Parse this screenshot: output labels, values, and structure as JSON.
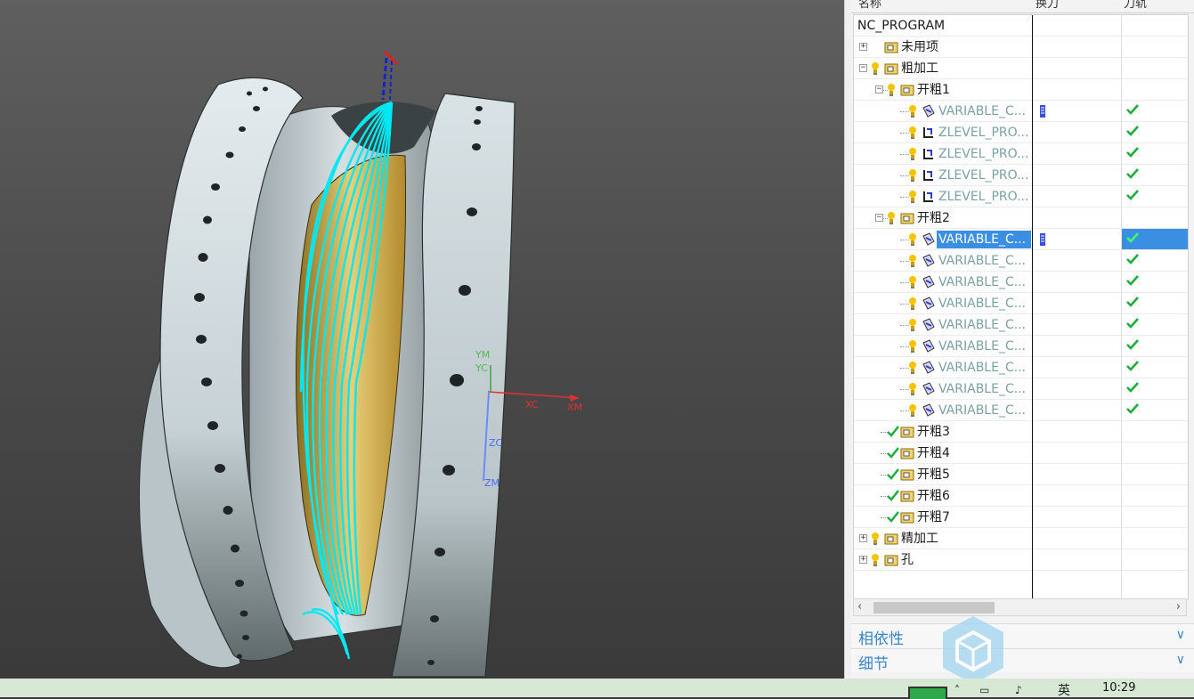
{
  "navigator": {
    "columns": {
      "name": "名称",
      "tool_change": "换刀",
      "toolpath": "刀轨"
    },
    "root": "NC_PROGRAM",
    "rows": [
      {
        "label": "未用项",
        "kind": "group",
        "level": 1,
        "expander": "+",
        "status": "none",
        "check": false
      },
      {
        "label": "粗加工",
        "kind": "group",
        "level": 1,
        "expander": "−",
        "status": "bulb",
        "check": false
      },
      {
        "label": "开粗1",
        "kind": "group",
        "level": 2,
        "expander": "−",
        "status": "bulb",
        "check": false
      },
      {
        "label": "VARIABLE_C...",
        "kind": "op-variable",
        "level": 3,
        "status": "bulb",
        "tool_change": true,
        "check": true
      },
      {
        "label": "ZLEVEL_PRO...",
        "kind": "op-zlevel",
        "level": 3,
        "status": "bulb",
        "tool_change": false,
        "check": true
      },
      {
        "label": "ZLEVEL_PRO...",
        "kind": "op-zlevel",
        "level": 3,
        "status": "bulb",
        "tool_change": false,
        "check": true
      },
      {
        "label": "ZLEVEL_PRO...",
        "kind": "op-zlevel",
        "level": 3,
        "status": "bulb",
        "tool_change": false,
        "check": true
      },
      {
        "label": "ZLEVEL_PRO...",
        "kind": "op-zlevel",
        "level": 3,
        "status": "bulb",
        "tool_change": false,
        "check": true
      },
      {
        "label": "开粗2",
        "kind": "group",
        "level": 2,
        "expander": "−",
        "status": "bulb",
        "check": false
      },
      {
        "label": "VARIABLE_C...",
        "kind": "op-variable",
        "level": 3,
        "status": "bulb",
        "tool_change": true,
        "check": true,
        "selected": true
      },
      {
        "label": "VARIABLE_C...",
        "kind": "op-variable",
        "level": 3,
        "status": "bulb",
        "tool_change": false,
        "check": true
      },
      {
        "label": "VARIABLE_C...",
        "kind": "op-variable",
        "level": 3,
        "status": "bulb",
        "tool_change": false,
        "check": true
      },
      {
        "label": "VARIABLE_C...",
        "kind": "op-variable",
        "level": 3,
        "status": "bulb",
        "tool_change": false,
        "check": true
      },
      {
        "label": "VARIABLE_C...",
        "kind": "op-variable",
        "level": 3,
        "status": "bulb",
        "tool_change": false,
        "check": true
      },
      {
        "label": "VARIABLE_C...",
        "kind": "op-variable",
        "level": 3,
        "status": "bulb",
        "tool_change": false,
        "check": true
      },
      {
        "label": "VARIABLE_C...",
        "kind": "op-variable",
        "level": 3,
        "status": "bulb",
        "tool_change": false,
        "check": true
      },
      {
        "label": "VARIABLE_C...",
        "kind": "op-variable",
        "level": 3,
        "status": "bulb",
        "tool_change": false,
        "check": true
      },
      {
        "label": "VARIABLE_C...",
        "kind": "op-variable",
        "level": 3,
        "status": "bulb",
        "tool_change": false,
        "check": true
      },
      {
        "label": "开粗3",
        "kind": "group",
        "level": 2,
        "status": "check",
        "check": false
      },
      {
        "label": "开粗4",
        "kind": "group",
        "level": 2,
        "status": "check",
        "check": false
      },
      {
        "label": "开粗5",
        "kind": "group",
        "level": 2,
        "status": "check",
        "check": false
      },
      {
        "label": "开粗6",
        "kind": "group",
        "level": 2,
        "status": "check",
        "check": false
      },
      {
        "label": "开粗7",
        "kind": "group",
        "level": 2,
        "status": "check",
        "check": false
      },
      {
        "label": "精加工",
        "kind": "group",
        "level": 1,
        "expander": "+",
        "status": "bulb",
        "check": false
      },
      {
        "label": "孔",
        "kind": "group",
        "level": 1,
        "expander": "+",
        "status": "bulb",
        "check": false
      }
    ]
  },
  "panels": {
    "dependencies": "相依性",
    "details": "细节"
  },
  "viewport": {
    "axis_labels": {
      "ym": "YM",
      "yc": "YC",
      "xc": "XC",
      "xm": "XM",
      "zc": "ZC",
      "zm": "ZM"
    }
  },
  "taskbar": {
    "time": "10:29",
    "ime": "英"
  },
  "colors": {
    "toolpath": "#00e5f0",
    "selection": "#3a8fe2",
    "check": "#1fae3c",
    "op_text": "#7aa0a6"
  }
}
